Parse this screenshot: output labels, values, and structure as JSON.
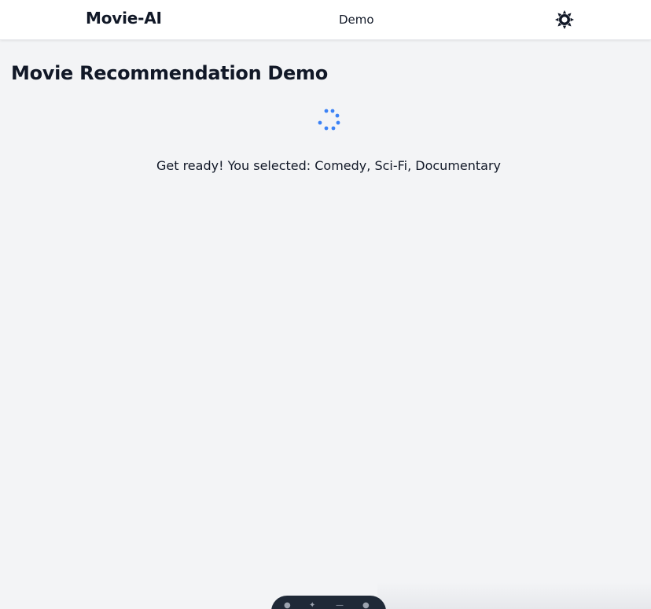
{
  "navbar": {
    "brand": "Movie-AI",
    "links": [
      {
        "label": "Demo"
      }
    ],
    "theme_toggle_icon": "sun-icon"
  },
  "main": {
    "title": "Movie Recommendation Demo",
    "loading_icon": "spinner-icon",
    "status_text": "Get ready! You selected: Comedy, Sci-Fi, Documentary"
  },
  "colors": {
    "background": "#f3f4f6",
    "navbar_bg": "#ffffff",
    "text": "#111827",
    "spinner": "#3b82f6"
  }
}
